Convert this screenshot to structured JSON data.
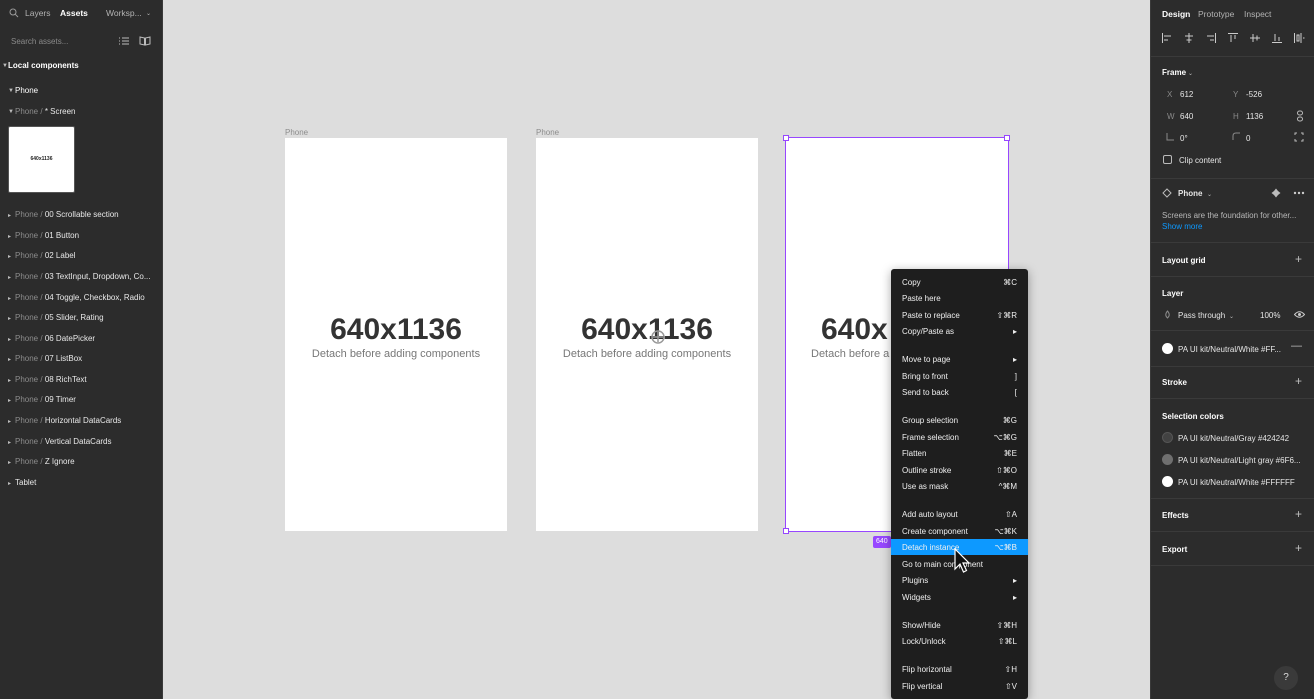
{
  "left_panel": {
    "tabs": [
      "Layers",
      "Assets",
      "Worksp..."
    ],
    "search_placeholder": "Search assets...",
    "section_title": "Local components",
    "group": "Phone",
    "subgroup_prefix": "Phone /",
    "subgroup_name": "* Screen",
    "thumbnail_text": "640x1136",
    "items": [
      {
        "prefix": "Phone /",
        "name": "00 Scrollable section"
      },
      {
        "prefix": "Phone /",
        "name": "01 Button"
      },
      {
        "prefix": "Phone /",
        "name": "02 Label"
      },
      {
        "prefix": "Phone /",
        "name": "03 TextInput, Dropdown, Co..."
      },
      {
        "prefix": "Phone /",
        "name": "04 Toggle, Checkbox, Radio"
      },
      {
        "prefix": "Phone /",
        "name": "05 Slider, Rating"
      },
      {
        "prefix": "Phone /",
        "name": "06 DatePicker"
      },
      {
        "prefix": "Phone /",
        "name": "07 ListBox"
      },
      {
        "prefix": "Phone /",
        "name": "08 RichText"
      },
      {
        "prefix": "Phone /",
        "name": "09 Timer"
      },
      {
        "prefix": "Phone /",
        "name": "Horizontal DataCards"
      },
      {
        "prefix": "Phone /",
        "name": "Vertical DataCards"
      },
      {
        "prefix": "Phone /",
        "name": "Z Ignore"
      }
    ],
    "tablet": "Tablet"
  },
  "canvas": {
    "frame_label": "Phone",
    "frame_title": "640x1136",
    "frame_subtitle": "Detach before adding components",
    "frame3_title": "640x",
    "frame3_subtitle": "Detach before a",
    "size_badge": "640"
  },
  "context_menu": [
    {
      "label": "Copy",
      "shortcut": "⌘C"
    },
    {
      "label": "Paste here",
      "shortcut": ""
    },
    {
      "label": "Paste to replace",
      "shortcut": "⇧⌘R"
    },
    {
      "label": "Copy/Paste as",
      "shortcut": "▸"
    },
    {
      "label": "Move to page",
      "shortcut": "▸"
    },
    {
      "label": "Bring to front",
      "shortcut": "]"
    },
    {
      "label": "Send to back",
      "shortcut": "["
    },
    {
      "label": "Group selection",
      "shortcut": "⌘G"
    },
    {
      "label": "Frame selection",
      "shortcut": "⌥⌘G"
    },
    {
      "label": "Flatten",
      "shortcut": "⌘E"
    },
    {
      "label": "Outline stroke",
      "shortcut": "⇧⌘O"
    },
    {
      "label": "Use as mask",
      "shortcut": "^⌘M"
    },
    {
      "label": "Add auto layout",
      "shortcut": "⇧A"
    },
    {
      "label": "Create component",
      "shortcut": "⌥⌘K"
    },
    {
      "label": "Detach instance",
      "shortcut": "⌥⌘B"
    },
    {
      "label": "Go to main component",
      "shortcut": ""
    },
    {
      "label": "Plugins",
      "shortcut": "▸"
    },
    {
      "label": "Widgets",
      "shortcut": "▸"
    },
    {
      "label": "Show/Hide",
      "shortcut": "⇧⌘H"
    },
    {
      "label": "Lock/Unlock",
      "shortcut": "⇧⌘L"
    },
    {
      "label": "Flip horizontal",
      "shortcut": "⇧H"
    },
    {
      "label": "Flip vertical",
      "shortcut": "⇧V"
    }
  ],
  "right_panel": {
    "tabs": [
      "Design",
      "Prototype",
      "Inspect"
    ],
    "frame_section": "Frame",
    "x_label": "X",
    "x_value": "612",
    "y_label": "Y",
    "y_value": "-526",
    "w_label": "W",
    "w_value": "640",
    "h_label": "H",
    "h_value": "1136",
    "rotation": "0°",
    "radius": "0",
    "clip_content": "Clip content",
    "component_name": "Phone",
    "component_desc": "Screens are the foundation for other...",
    "show_more": "Show more",
    "layout_grid": "Layout grid",
    "layer": "Layer",
    "blend_mode": "Pass through",
    "opacity": "100%",
    "fill_name": "PA UI kit/Neutral/White #FF...",
    "stroke": "Stroke",
    "selection_colors": "Selection colors",
    "colors": [
      {
        "name": "PA UI kit/Neutral/Gray #424242",
        "hex": "#424242"
      },
      {
        "name": "PA UI kit/Neutral/Light gray #6F6...",
        "hex": "#6f6f6f"
      },
      {
        "name": "PA UI kit/Neutral/White #FFFFFF",
        "hex": "#ffffff"
      }
    ],
    "effects": "Effects",
    "export": "Export",
    "help": "?"
  }
}
